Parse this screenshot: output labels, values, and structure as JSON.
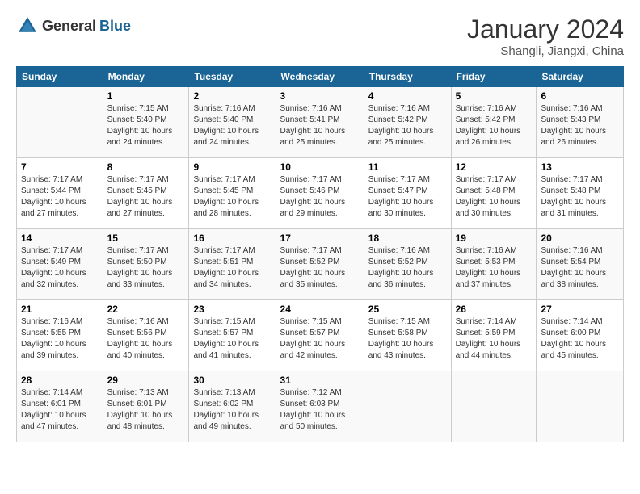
{
  "header": {
    "logo_general": "General",
    "logo_blue": "Blue",
    "month_title": "January 2024",
    "subtitle": "Shangli, Jiangxi, China"
  },
  "days_of_week": [
    "Sunday",
    "Monday",
    "Tuesday",
    "Wednesday",
    "Thursday",
    "Friday",
    "Saturday"
  ],
  "weeks": [
    [
      {
        "day": "",
        "sunrise": "",
        "sunset": "",
        "daylight": ""
      },
      {
        "day": "1",
        "sunrise": "Sunrise: 7:15 AM",
        "sunset": "Sunset: 5:40 PM",
        "daylight": "Daylight: 10 hours and 24 minutes."
      },
      {
        "day": "2",
        "sunrise": "Sunrise: 7:16 AM",
        "sunset": "Sunset: 5:40 PM",
        "daylight": "Daylight: 10 hours and 24 minutes."
      },
      {
        "day": "3",
        "sunrise": "Sunrise: 7:16 AM",
        "sunset": "Sunset: 5:41 PM",
        "daylight": "Daylight: 10 hours and 25 minutes."
      },
      {
        "day": "4",
        "sunrise": "Sunrise: 7:16 AM",
        "sunset": "Sunset: 5:42 PM",
        "daylight": "Daylight: 10 hours and 25 minutes."
      },
      {
        "day": "5",
        "sunrise": "Sunrise: 7:16 AM",
        "sunset": "Sunset: 5:42 PM",
        "daylight": "Daylight: 10 hours and 26 minutes."
      },
      {
        "day": "6",
        "sunrise": "Sunrise: 7:16 AM",
        "sunset": "Sunset: 5:43 PM",
        "daylight": "Daylight: 10 hours and 26 minutes."
      }
    ],
    [
      {
        "day": "7",
        "sunrise": "Sunrise: 7:17 AM",
        "sunset": "Sunset: 5:44 PM",
        "daylight": "Daylight: 10 hours and 27 minutes."
      },
      {
        "day": "8",
        "sunrise": "Sunrise: 7:17 AM",
        "sunset": "Sunset: 5:45 PM",
        "daylight": "Daylight: 10 hours and 27 minutes."
      },
      {
        "day": "9",
        "sunrise": "Sunrise: 7:17 AM",
        "sunset": "Sunset: 5:45 PM",
        "daylight": "Daylight: 10 hours and 28 minutes."
      },
      {
        "day": "10",
        "sunrise": "Sunrise: 7:17 AM",
        "sunset": "Sunset: 5:46 PM",
        "daylight": "Daylight: 10 hours and 29 minutes."
      },
      {
        "day": "11",
        "sunrise": "Sunrise: 7:17 AM",
        "sunset": "Sunset: 5:47 PM",
        "daylight": "Daylight: 10 hours and 30 minutes."
      },
      {
        "day": "12",
        "sunrise": "Sunrise: 7:17 AM",
        "sunset": "Sunset: 5:48 PM",
        "daylight": "Daylight: 10 hours and 30 minutes."
      },
      {
        "day": "13",
        "sunrise": "Sunrise: 7:17 AM",
        "sunset": "Sunset: 5:48 PM",
        "daylight": "Daylight: 10 hours and 31 minutes."
      }
    ],
    [
      {
        "day": "14",
        "sunrise": "Sunrise: 7:17 AM",
        "sunset": "Sunset: 5:49 PM",
        "daylight": "Daylight: 10 hours and 32 minutes."
      },
      {
        "day": "15",
        "sunrise": "Sunrise: 7:17 AM",
        "sunset": "Sunset: 5:50 PM",
        "daylight": "Daylight: 10 hours and 33 minutes."
      },
      {
        "day": "16",
        "sunrise": "Sunrise: 7:17 AM",
        "sunset": "Sunset: 5:51 PM",
        "daylight": "Daylight: 10 hours and 34 minutes."
      },
      {
        "day": "17",
        "sunrise": "Sunrise: 7:17 AM",
        "sunset": "Sunset: 5:52 PM",
        "daylight": "Daylight: 10 hours and 35 minutes."
      },
      {
        "day": "18",
        "sunrise": "Sunrise: 7:16 AM",
        "sunset": "Sunset: 5:52 PM",
        "daylight": "Daylight: 10 hours and 36 minutes."
      },
      {
        "day": "19",
        "sunrise": "Sunrise: 7:16 AM",
        "sunset": "Sunset: 5:53 PM",
        "daylight": "Daylight: 10 hours and 37 minutes."
      },
      {
        "day": "20",
        "sunrise": "Sunrise: 7:16 AM",
        "sunset": "Sunset: 5:54 PM",
        "daylight": "Daylight: 10 hours and 38 minutes."
      }
    ],
    [
      {
        "day": "21",
        "sunrise": "Sunrise: 7:16 AM",
        "sunset": "Sunset: 5:55 PM",
        "daylight": "Daylight: 10 hours and 39 minutes."
      },
      {
        "day": "22",
        "sunrise": "Sunrise: 7:16 AM",
        "sunset": "Sunset: 5:56 PM",
        "daylight": "Daylight: 10 hours and 40 minutes."
      },
      {
        "day": "23",
        "sunrise": "Sunrise: 7:15 AM",
        "sunset": "Sunset: 5:57 PM",
        "daylight": "Daylight: 10 hours and 41 minutes."
      },
      {
        "day": "24",
        "sunrise": "Sunrise: 7:15 AM",
        "sunset": "Sunset: 5:57 PM",
        "daylight": "Daylight: 10 hours and 42 minutes."
      },
      {
        "day": "25",
        "sunrise": "Sunrise: 7:15 AM",
        "sunset": "Sunset: 5:58 PM",
        "daylight": "Daylight: 10 hours and 43 minutes."
      },
      {
        "day": "26",
        "sunrise": "Sunrise: 7:14 AM",
        "sunset": "Sunset: 5:59 PM",
        "daylight": "Daylight: 10 hours and 44 minutes."
      },
      {
        "day": "27",
        "sunrise": "Sunrise: 7:14 AM",
        "sunset": "Sunset: 6:00 PM",
        "daylight": "Daylight: 10 hours and 45 minutes."
      }
    ],
    [
      {
        "day": "28",
        "sunrise": "Sunrise: 7:14 AM",
        "sunset": "Sunset: 6:01 PM",
        "daylight": "Daylight: 10 hours and 47 minutes."
      },
      {
        "day": "29",
        "sunrise": "Sunrise: 7:13 AM",
        "sunset": "Sunset: 6:01 PM",
        "daylight": "Daylight: 10 hours and 48 minutes."
      },
      {
        "day": "30",
        "sunrise": "Sunrise: 7:13 AM",
        "sunset": "Sunset: 6:02 PM",
        "daylight": "Daylight: 10 hours and 49 minutes."
      },
      {
        "day": "31",
        "sunrise": "Sunrise: 7:12 AM",
        "sunset": "Sunset: 6:03 PM",
        "daylight": "Daylight: 10 hours and 50 minutes."
      },
      {
        "day": "",
        "sunrise": "",
        "sunset": "",
        "daylight": ""
      },
      {
        "day": "",
        "sunrise": "",
        "sunset": "",
        "daylight": ""
      },
      {
        "day": "",
        "sunrise": "",
        "sunset": "",
        "daylight": ""
      }
    ]
  ]
}
